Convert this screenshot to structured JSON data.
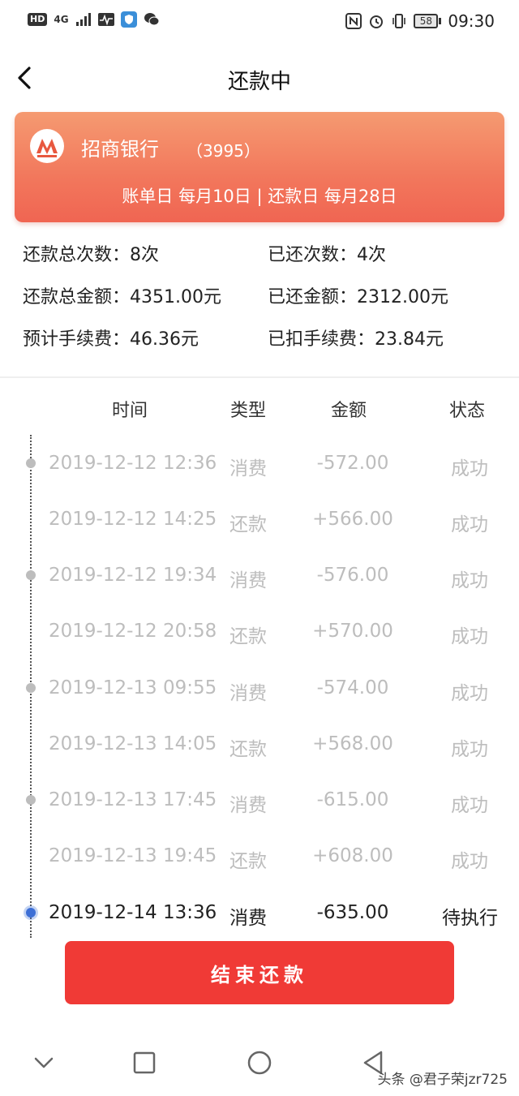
{
  "status_bar": {
    "left_badge": "HD",
    "network": "4G",
    "battery": "58",
    "time": "09:30",
    "icons": [
      "signal-icon",
      "pulse-icon",
      "shield-app-icon",
      "wechat-icon",
      "nfc-icon",
      "alarm-icon",
      "vibrate-icon",
      "battery-icon"
    ]
  },
  "header": {
    "title": "还款中",
    "back_icon": "chevron-left-icon"
  },
  "card": {
    "bank_name": "招商银行",
    "card_tail": "（3995）",
    "bill_day_text": "账单日  每月10日 | 还款日  每月28日",
    "colors": {
      "start": "#f59a71",
      "end": "#f06552"
    }
  },
  "summary": {
    "rows": [
      {
        "left": "还款总次数：8次",
        "right": "已还次数：4次"
      },
      {
        "left": "还款总金额：4351.00元",
        "right": "已还金额：2312.00元"
      },
      {
        "left": "预计手续费：46.36元",
        "right": "已扣手续费：23.84元"
      }
    ]
  },
  "table": {
    "headers": {
      "time": "时间",
      "type": "类型",
      "amount": "金额",
      "status": "状态"
    },
    "rows": [
      {
        "time": "2019-12-12 12:36",
        "type": "消费",
        "amount": "-572.00",
        "status": "成功"
      },
      {
        "time": "2019-12-12 14:25",
        "type": "还款",
        "amount": "+566.00",
        "status": "成功"
      },
      {
        "time": "2019-12-12 19:34",
        "type": "消费",
        "amount": "-576.00",
        "status": "成功"
      },
      {
        "time": "2019-12-12 20:58",
        "type": "还款",
        "amount": "+570.00",
        "status": "成功"
      },
      {
        "time": "2019-12-13 09:55",
        "type": "消费",
        "amount": "-574.00",
        "status": "成功"
      },
      {
        "time": "2019-12-13 14:05",
        "type": "还款",
        "amount": "+568.00",
        "status": "成功"
      },
      {
        "time": "2019-12-13 17:45",
        "type": "消费",
        "amount": "-615.00",
        "status": "成功"
      },
      {
        "time": "2019-12-13 19:45",
        "type": "还款",
        "amount": "+608.00",
        "status": "成功"
      },
      {
        "time": "2019-12-14 13:36",
        "type": "消费",
        "amount": "-635.00",
        "status": "待执行"
      }
    ],
    "active_color": "#3d6fd6"
  },
  "end_button": {
    "label": "结束还款",
    "color": "#f03a36"
  },
  "nav": {
    "icons": [
      "nav-back-icon",
      "nav-home-icon",
      "nav-recents-icon",
      "nav-collapse-icon"
    ]
  },
  "watermark": "头条 @君子荣jzr725"
}
